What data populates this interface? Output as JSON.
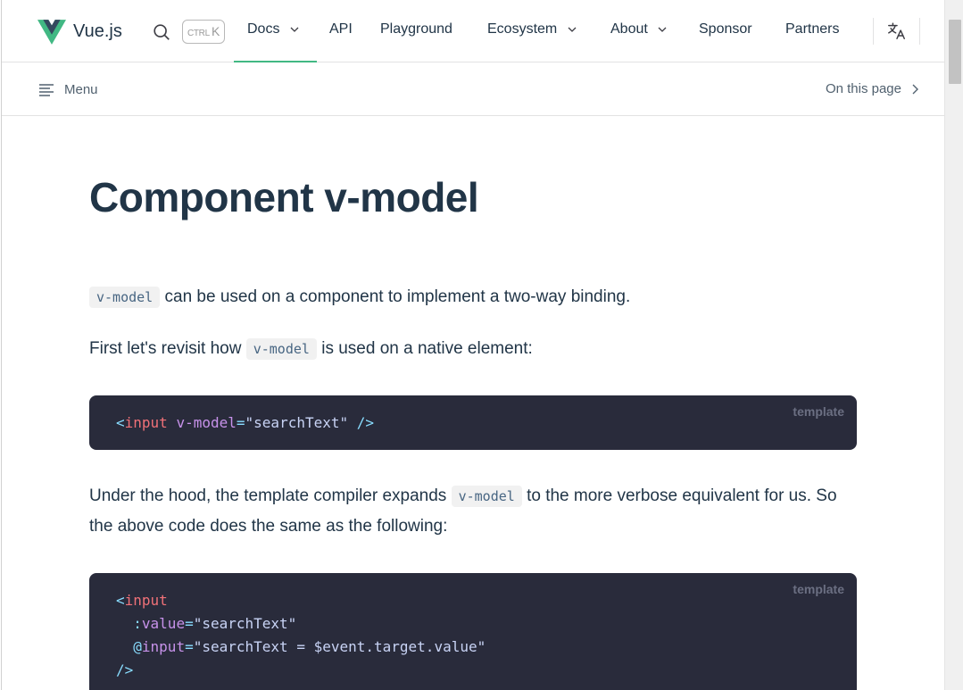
{
  "nav": {
    "brand": "Vue.js",
    "kbd_ctrl": "CTRL",
    "kbd_key": "K",
    "items": [
      {
        "label": "Docs"
      },
      {
        "label": "API"
      },
      {
        "label": "Playground"
      },
      {
        "label": "Ecosystem"
      },
      {
        "label": "About"
      },
      {
        "label": "Sponsor"
      },
      {
        "label": "Partners"
      }
    ]
  },
  "localnav": {
    "menu_label": "Menu",
    "on_this_page": "On this page"
  },
  "article": {
    "title": "Component v-model",
    "p1_code": "v-model",
    "p1_text": " can be used on a component to implement a two-way binding.",
    "p2_before": "First let's revisit how ",
    "p2_code": "v-model",
    "p2_after": " is used on a native element:",
    "code1_lang": "template",
    "p3_before": "Under the hood, the template compiler expands ",
    "p3_code": "v-model",
    "p3_after": " to the more verbose equivalent for us. So the above code does the same as the following:",
    "code2_lang": "template"
  },
  "code1": {
    "lt": "<",
    "tag": "input",
    "attr": "v-model",
    "eq": "=",
    "str": "\"searchText\"",
    "close": " />"
  },
  "code2": {
    "l1_lt": "<",
    "l1_tag": "input",
    "l2_colon": "  :",
    "l2_attr": "value",
    "l2_eq": "=",
    "l2_str": "\"searchText\"",
    "l3_at": "  @",
    "l3_attr": "input",
    "l3_eq": "=",
    "l3_str": "\"searchText = $event.target.value\"",
    "l4": "/>"
  },
  "colors": {
    "brand_green": "#42b883",
    "brand_dark": "#35495e",
    "code_bg": "#292b3b"
  }
}
